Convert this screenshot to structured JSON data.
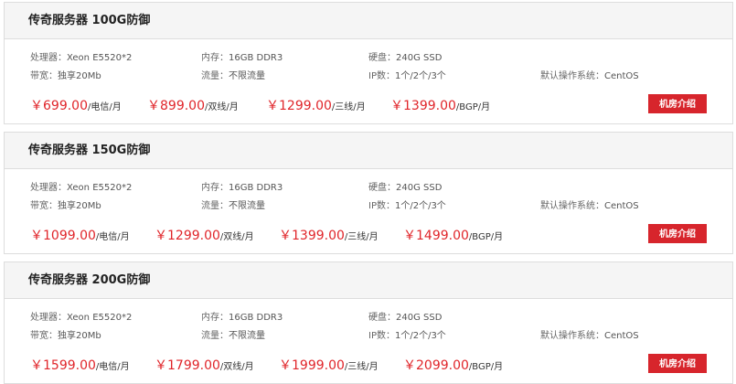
{
  "servers": [
    {
      "title": "传奇服务器 100G防御",
      "specs": {
        "cpu_label": "处理器：",
        "cpu": "Xeon E5520*2",
        "ram_label": "内存：",
        "ram": "16GB DDR3",
        "disk_label": "硬盘：",
        "disk": "240G SSD",
        "bw_label": "带宽：",
        "bw": "独享20Mb",
        "traffic_label": "流量：",
        "traffic": "不限流量",
        "ip_label": "IP数：",
        "ip": "1个/2个/3个",
        "os_label": "默认操作系统：",
        "os": "CentOS"
      },
      "prices": [
        {
          "amount": "￥699.00",
          "unit": "/电信/月"
        },
        {
          "amount": "￥899.00",
          "unit": "/双线/月"
        },
        {
          "amount": "￥1299.00",
          "unit": "/三线/月"
        },
        {
          "amount": "￥1399.00",
          "unit": "/BGP/月"
        }
      ],
      "button": "机房介绍"
    },
    {
      "title": "传奇服务器 150G防御",
      "specs": {
        "cpu_label": "处理器：",
        "cpu": "Xeon E5520*2",
        "ram_label": "内存：",
        "ram": "16GB DDR3",
        "disk_label": "硬盘：",
        "disk": "240G SSD",
        "bw_label": "带宽：",
        "bw": "独享20Mb",
        "traffic_label": "流量：",
        "traffic": "不限流量",
        "ip_label": "IP数：",
        "ip": "1个/2个/3个",
        "os_label": "默认操作系统：",
        "os": "CentOS"
      },
      "prices": [
        {
          "amount": "￥1099.00",
          "unit": "/电信/月"
        },
        {
          "amount": "￥1299.00",
          "unit": "/双线/月"
        },
        {
          "amount": "￥1399.00",
          "unit": "/三线/月"
        },
        {
          "amount": "￥1499.00",
          "unit": "/BGP/月"
        }
      ],
      "button": "机房介绍"
    },
    {
      "title": "传奇服务器 200G防御",
      "specs": {
        "cpu_label": "处理器：",
        "cpu": "Xeon E5520*2",
        "ram_label": "内存：",
        "ram": "16GB DDR3",
        "disk_label": "硬盘：",
        "disk": "240G SSD",
        "bw_label": "带宽：",
        "bw": "独享20Mb",
        "traffic_label": "流量：",
        "traffic": "不限流量",
        "ip_label": "IP数：",
        "ip": "1个/2个/3个",
        "os_label": "默认操作系统：",
        "os": "CentOS"
      },
      "prices": [
        {
          "amount": "￥1599.00",
          "unit": "/电信/月"
        },
        {
          "amount": "￥1799.00",
          "unit": "/双线/月"
        },
        {
          "amount": "￥1999.00",
          "unit": "/三线/月"
        },
        {
          "amount": "￥2099.00",
          "unit": "/BGP/月"
        }
      ],
      "button": "机房介绍"
    }
  ]
}
